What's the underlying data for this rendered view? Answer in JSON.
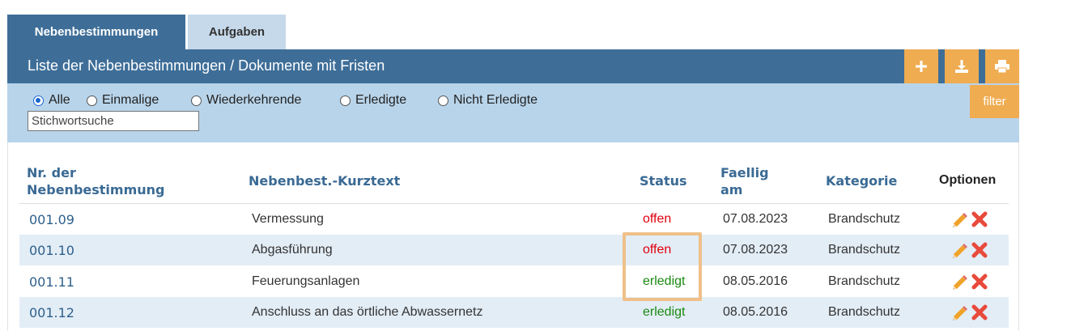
{
  "tabs": [
    {
      "label": "Nebenbestimmungen",
      "active": true
    },
    {
      "label": "Aufgaben",
      "active": false
    }
  ],
  "header": {
    "title": "Liste der Nebenbestimmungen / Dokumente mit Fristen",
    "buttons": [
      {
        "icon": "plus-icon"
      },
      {
        "icon": "download-icon"
      },
      {
        "icon": "print-icon"
      }
    ]
  },
  "filters": {
    "radios": [
      {
        "label": "Alle",
        "checked": true
      },
      {
        "label": "Einmalige",
        "checked": false
      },
      {
        "label": "Wiederkehrende",
        "checked": false
      },
      {
        "label": "Erledigte",
        "checked": false
      },
      {
        "label": "Nicht Erledigte",
        "checked": false
      }
    ],
    "search_placeholder": "Stichwortsuche",
    "filter_button": "filter"
  },
  "table": {
    "columns": {
      "nr_line1": "Nr. der",
      "nr_line2": "Nebenbestimmung",
      "kurztext": "Nebenbest.-Kurztext",
      "status": "Status",
      "faellig_line1": "Faellig",
      "faellig_line2": "am",
      "kategorie": "Kategorie",
      "optionen": "Optionen"
    },
    "rows": [
      {
        "nr": "001.09",
        "text": "Vermessung",
        "status": "offen",
        "date": "07.08.2023",
        "kategorie": "Brandschutz"
      },
      {
        "nr": "001.10",
        "text": "Abgasführung",
        "status": "offen",
        "date": "07.08.2023",
        "kategorie": "Brandschutz"
      },
      {
        "nr": "001.11",
        "text": "Feuerungsanlagen",
        "status": "erledigt",
        "date": "08.05.2016",
        "kategorie": "Brandschutz"
      },
      {
        "nr": "001.12",
        "text": "Anschluss an das örtliche Abwassernetz",
        "status": "erledigt",
        "date": "08.05.2016",
        "kategorie": "Brandschutz"
      }
    ]
  },
  "colors": {
    "primary": "#3e6e98",
    "accent": "#efac51",
    "filter_bg": "#b8d4ea",
    "status_offen": "#e0000f",
    "status_erledigt": "#1a8a10"
  }
}
